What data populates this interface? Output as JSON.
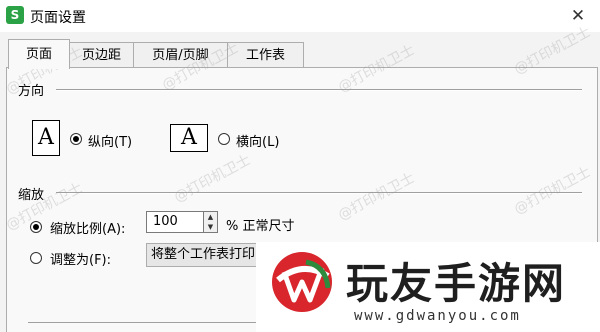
{
  "window": {
    "app_icon_letter": "S",
    "title": "页面设置",
    "close_glyph": "✕"
  },
  "tabs": [
    {
      "label": "页面",
      "active": true
    },
    {
      "label": "页边距",
      "active": false
    },
    {
      "label": "页眉/页脚",
      "active": false
    },
    {
      "label": "工作表",
      "active": false
    }
  ],
  "orientation": {
    "group_label": "方向",
    "page_glyph": "A",
    "portrait_label": "纵向(T)",
    "landscape_label": "横向(L)",
    "selected": "portrait"
  },
  "scaling": {
    "group_label": "缩放",
    "scale_label": "缩放比例(A):",
    "scale_value": "100",
    "scale_unit": "% 正常尺寸",
    "fit_label": "调整为(F):",
    "fit_select_value": "将整个工作表打印",
    "selected": "scale"
  },
  "watermark_text": "@打印机卫士",
  "overlay_logo": {
    "name": "玩友手游网",
    "url": "www.gdwanyou.com",
    "accent_red": "#d8262c",
    "accent_green": "#2e8b3d"
  }
}
